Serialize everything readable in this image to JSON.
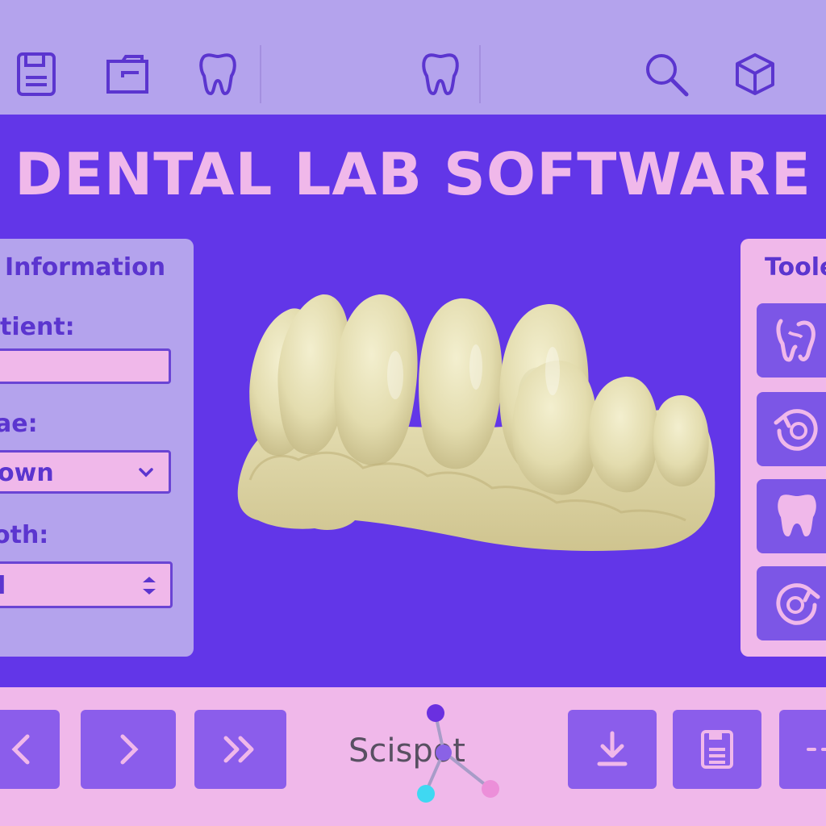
{
  "toolbar": {
    "icons": [
      "save-icon",
      "open-folder-icon",
      "tooth-icon",
      "tooth-view-icon",
      "search-icon",
      "3d-cube-icon"
    ]
  },
  "title": "DENTAL LAB SOFTWARE",
  "info_panel": {
    "heading": "Information",
    "patient_label": "tient:",
    "patient_value": "",
    "type_label": "ae:",
    "type_value": "own",
    "tooth_label": "oth:",
    "tooth_value": "l"
  },
  "tools_panel": {
    "heading": "Toole",
    "tools": [
      "tooth-root-tool-icon",
      "rotate-tool-icon",
      "tooth-tool-icon",
      "rotate-back-tool-icon"
    ]
  },
  "bottom": {
    "buttons": [
      "prev-icon",
      "next-icon",
      "fast-forward-icon",
      "download-icon",
      "save-file-icon",
      "more-icon"
    ],
    "logo_text": "Scispot"
  },
  "colors": {
    "background": "#6236e8",
    "toolbar": "#b4a3ed",
    "accent_pink": "#f0b8ea",
    "button_purple": "#8b5deb",
    "icon_stroke": "#5b35cf"
  }
}
